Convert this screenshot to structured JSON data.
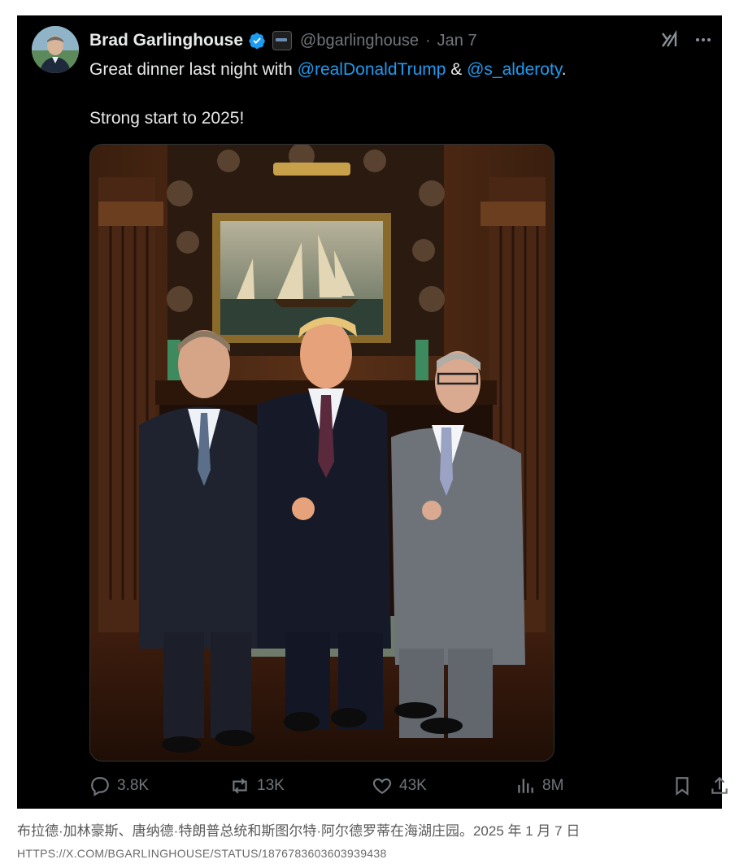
{
  "tweet": {
    "author_name": "Brad Garlinghouse",
    "handle": "@bgarlinghouse",
    "separator": "·",
    "date": "Jan 7",
    "text_line1_prefix": "Great dinner last night with ",
    "mention1": "@realDonaldTrump",
    "text_line1_mid": " & ",
    "mention2": "@s_alderoty",
    "text_line1_suffix": ".",
    "text_line2": "Strong start to 2025!",
    "photo_icon": "group-photo-three-men-formal-dining-room",
    "verified_icon": "verified-badge-icon",
    "accent_color": "#1d9bf0",
    "background_color": "#000000"
  },
  "actions": {
    "replies": "3.8K",
    "reposts": "13K",
    "likes": "43K",
    "views": "8M"
  },
  "caption": {
    "text": "布拉德·加林豪斯、唐纳德·特朗普总统和斯图尔特·阿尔德罗蒂在海湖庄园。2025 年 1 月 7 日",
    "source": "HTTPS://X.COM/BGARLINGHOUSE/STATUS/1876783603603939438"
  }
}
